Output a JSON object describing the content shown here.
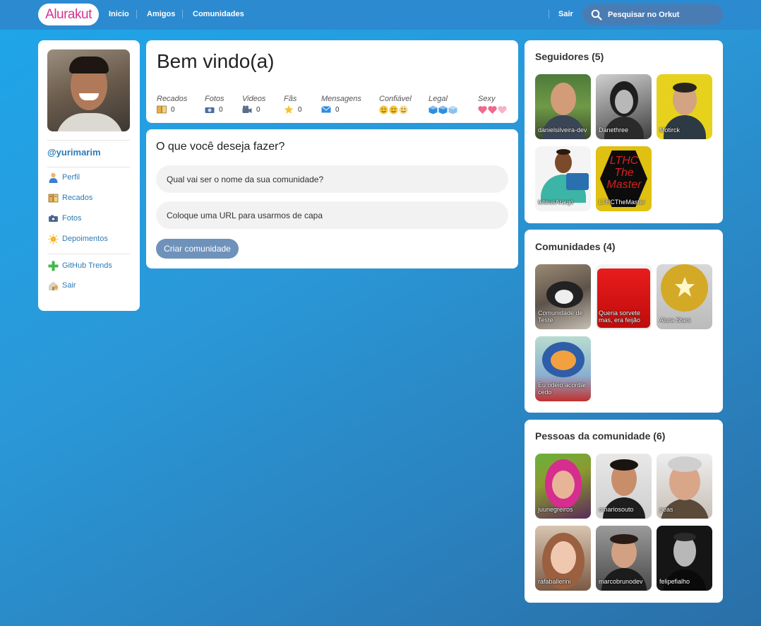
{
  "topbar": {
    "logo": "Alurakut",
    "nav": [
      "Inicio",
      "Amigos",
      "Comunidades"
    ],
    "logout": "Sair",
    "search_placeholder": "Pesquisar no Orkut"
  },
  "sidebar": {
    "username": "@yurimarim",
    "items": [
      {
        "label": "Perfil",
        "icon": "user-icon"
      },
      {
        "label": "Recados",
        "icon": "book-icon"
      },
      {
        "label": "Fotos",
        "icon": "camera-icon"
      },
      {
        "label": "Depoimentos",
        "icon": "sun-icon"
      },
      {
        "label": "GitHub Trends",
        "icon": "plus-icon"
      },
      {
        "label": "Sair",
        "icon": "logout-icon"
      }
    ]
  },
  "welcome": {
    "title": "Bem vindo(a)",
    "stats": [
      {
        "name": "Recados",
        "value": "0",
        "icon": "book-icon"
      },
      {
        "name": "Fotos",
        "value": "0",
        "icon": "camera-icon"
      },
      {
        "name": "Videos",
        "value": "0",
        "icon": "video-icon"
      },
      {
        "name": "Fãs",
        "value": "0",
        "icon": "star-icon"
      },
      {
        "name": "Mensagens",
        "value": "0",
        "icon": "mail-icon"
      },
      {
        "name": "Confiável",
        "icon": "smiley-icon"
      },
      {
        "name": "Legal",
        "icon": "cube-icon"
      },
      {
        "name": "Sexy",
        "icon": "heart-icon"
      }
    ]
  },
  "form": {
    "title": "O que você deseja fazer?",
    "name_placeholder": "Qual vai ser o nome da sua comunidade?",
    "url_placeholder": "Coloque uma URL para usarmos de capa",
    "submit": "Criar comunidade"
  },
  "followers": {
    "title": "Seguidores (5)",
    "items": [
      "danielsilveira-dev",
      "Danethree",
      "Motirck",
      "teteusAraujo",
      "LTHCTheMaster"
    ]
  },
  "communities": {
    "title": "Comunidades (4)",
    "items": [
      "Comunidade de Teste",
      "Queria sorvete mas, era feijão",
      "Alura Stars",
      "Eu odeio acordar cedo"
    ]
  },
  "people": {
    "title": "Pessoas da comunidade (6)",
    "items": [
      "juunegreiros",
      "omariosouto",
      "peas",
      "rafaballerini",
      "marcobrunodev",
      "felipefialho"
    ]
  },
  "colors": {
    "accent": "#2e7bb4",
    "logo": "#d6338c",
    "button": "#6f92bb",
    "topbar": "#2c8ad0"
  }
}
